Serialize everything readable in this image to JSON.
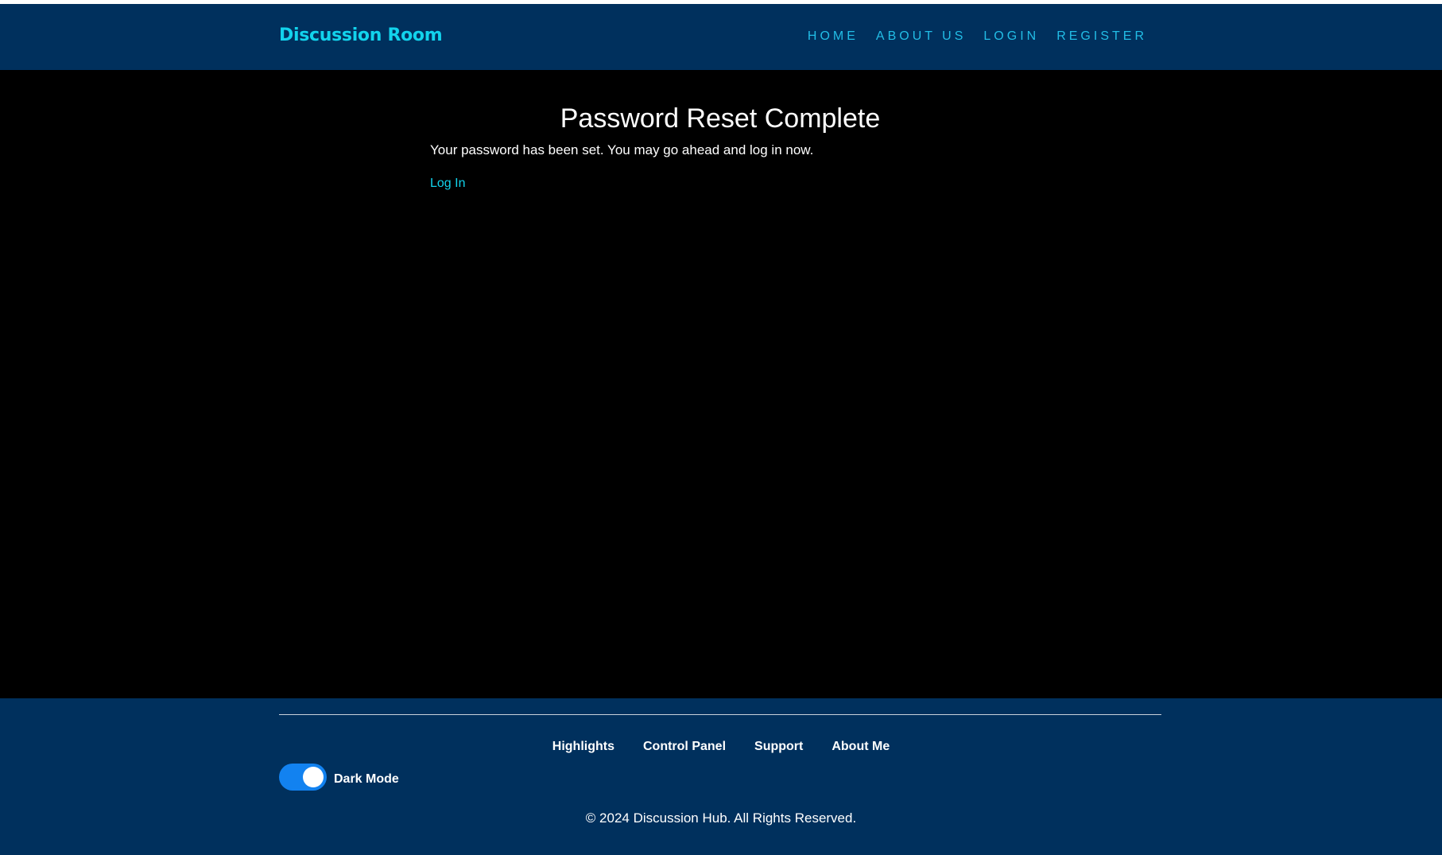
{
  "colors": {
    "navbar_bg": "#00305d",
    "body_bg": "#000000",
    "brand": "#12d3ec",
    "nav_link": "#22bde6",
    "link_accent": "#12d3ec",
    "toggle_on": "#1282f0",
    "text": "#ffffff"
  },
  "navbar": {
    "brand": "Discussion Room",
    "links": [
      "HOME",
      "ABOUT US",
      "LOGIN",
      "REGISTER"
    ]
  },
  "main": {
    "title": "Password Reset Complete",
    "message": "Your password has been set. You may go ahead and log in now.",
    "login_link": "Log In"
  },
  "footer": {
    "links": [
      "Highlights",
      "Control Panel",
      "Support",
      "About Me"
    ],
    "dark_mode": {
      "label": "Dark Mode",
      "enabled": true
    },
    "copyright": "© 2024 Discussion Hub. All Rights Reserved."
  }
}
